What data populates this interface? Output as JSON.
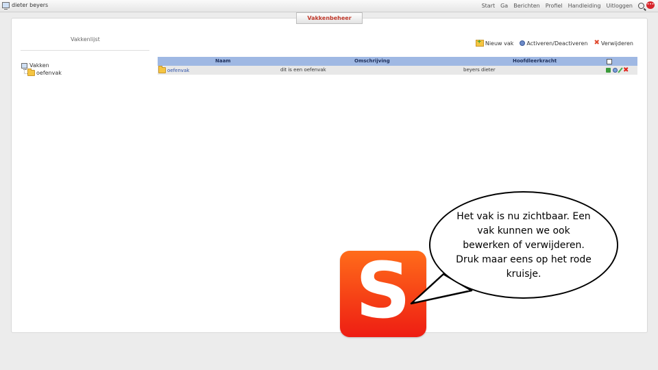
{
  "topbar": {
    "user_name": "dieter beyers",
    "nav": [
      "Start",
      "Ga",
      "Berichten",
      "Profiel",
      "Handleiding",
      "Uitloggen"
    ],
    "chat_badge": "•••"
  },
  "page": {
    "title": "Vakkenbeheer"
  },
  "left": {
    "title": "Vakkenlijst",
    "tree_root": "Vakken",
    "tree_child": "oefenvak"
  },
  "actions": {
    "new": "Nieuw vak",
    "toggle": "Activeren/Deactiveren",
    "delete": "Verwijderen"
  },
  "table": {
    "headers": {
      "naam": "Naam",
      "omschrijving": "Omschrijving",
      "hoofdleerkracht": "Hoofdleerkracht"
    },
    "rows": [
      {
        "naam": "oefenvak",
        "omschrijving": "dit is een oefenvak",
        "hoofdleerkracht": "beyers dieter"
      }
    ]
  },
  "logo": {
    "letter": "S"
  },
  "bubble": {
    "text": "Het vak is nu zichtbaar. Een vak kunnen we ook bewerken of verwijderen. Druk maar eens op het rode kruisje."
  },
  "colors": {
    "header_bg": "#9fb8e3",
    "row_bg": "#e8e8e8",
    "logo_top": "#ff6c1a",
    "logo_bottom": "#ee1d13",
    "tab_text": "#c0392b"
  }
}
